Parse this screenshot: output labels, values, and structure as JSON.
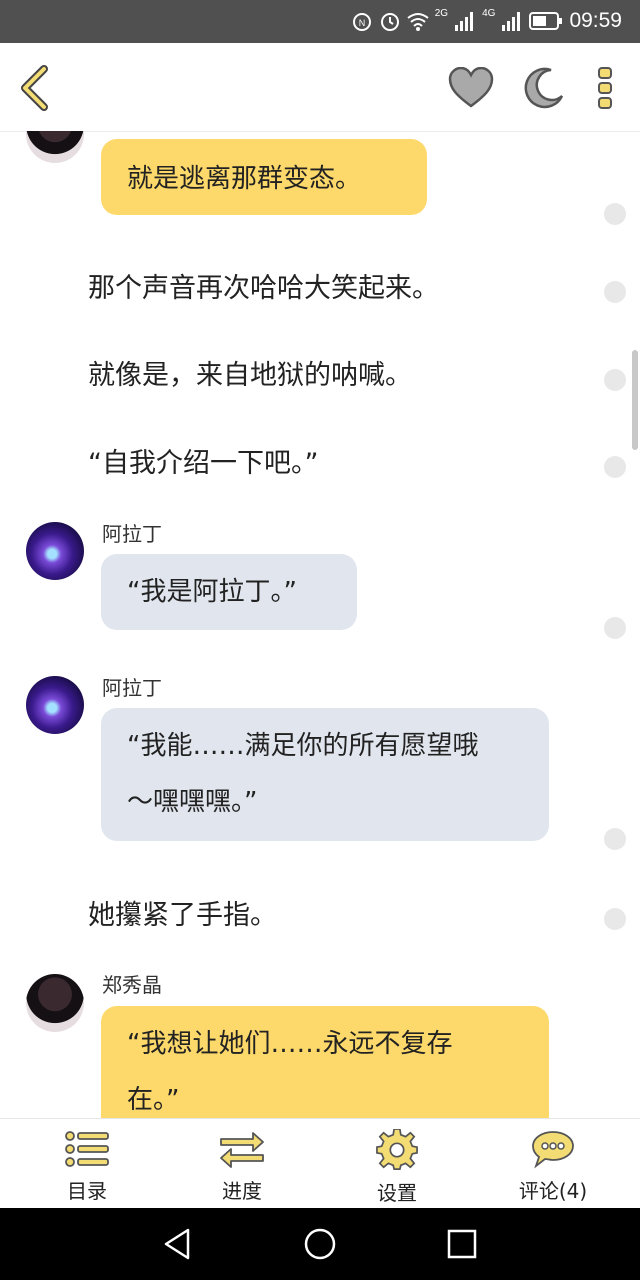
{
  "status_bar": {
    "time": "09:59",
    "network_1": "2G",
    "network_2": "4G"
  },
  "top_bar": {
    "back": "back-icon",
    "like": "heart-icon",
    "night": "moon-icon",
    "menu": "more-vert-icon"
  },
  "messages": {
    "m1": {
      "text": "就是逃离那群变态。"
    },
    "n1": {
      "text": "那个声音再次哈哈大笑起来。"
    },
    "n2": {
      "text": "就像是，来自地狱的呐喊。"
    },
    "n3": {
      "text": "“自我介绍一下吧。”"
    },
    "m2": {
      "name": "阿拉丁",
      "text": "“我是阿拉丁。”"
    },
    "m3": {
      "name": "阿拉丁",
      "line1": "“我能……满足你的所有愿望哦",
      "line2": "～嘿嘿嘿。”"
    },
    "n4": {
      "text": "她攥紧了手指。"
    },
    "m4": {
      "name": "郑秀晶",
      "line1": "“我想让她们……永远不复存",
      "line2": "在。”"
    }
  },
  "bottom_bar": {
    "catalog": "目录",
    "progress": "进度",
    "settings": "设置",
    "comments": "评论(4)"
  },
  "colors": {
    "accent": "#fcd96a",
    "bubble_gray": "#e1e6ee",
    "icon_yellow": "#f3dc73"
  }
}
